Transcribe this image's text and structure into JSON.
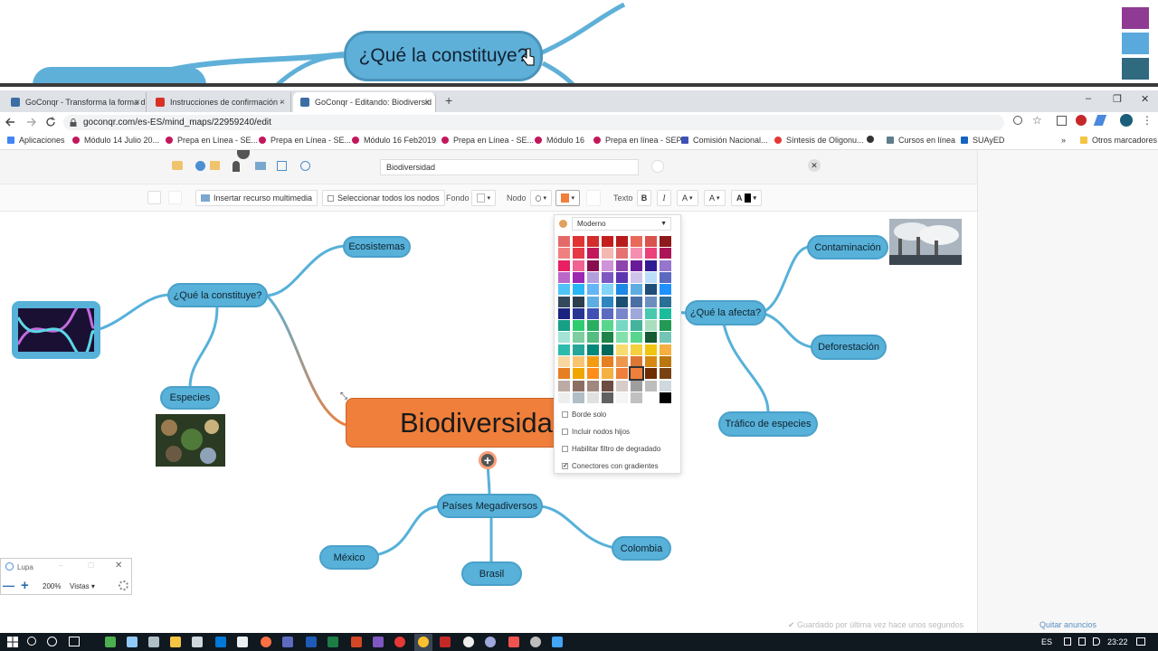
{
  "magnifier": {
    "node_text": "¿Qué la constituye?"
  },
  "tabs": [
    {
      "label": "GoConqr - Transforma la forma d",
      "close": "×"
    },
    {
      "label": "Instrucciones de confirmación - ",
      "close": "×"
    },
    {
      "label": "GoConqr - Editando: Biodiversid",
      "close": "×"
    }
  ],
  "new_tab": "+",
  "window": {
    "minimize": "–",
    "maximize": "❐",
    "close": "✕"
  },
  "address": {
    "url": "goconqr.com/es-ES/mind_maps/22959240/edit"
  },
  "bookmarks": [
    "Aplicaciones",
    "Módulo 14 Julio 20...",
    "Prepa en Línea - SE...",
    "Prepa en Línea - SE...",
    "Módulo 16 Feb2019",
    "Prepa en Línea - SE...",
    "Módulo 16",
    "Prepa en línea - SEP",
    "Comisión Nacional...",
    "Síntesis de Oligonu...",
    "",
    "Cursos en línea",
    "SUAyED"
  ],
  "bookmarks_more": "»",
  "bookmarks_other": "Otros marcadores",
  "editor": {
    "title_value": "Biodiversidad",
    "insert_media": "Insertar recurso multimedia",
    "select_all": "Seleccionar todos los nodos",
    "fondo_label": "Fondo",
    "nodo_label": "Nodo",
    "texto_label": "Texto",
    "bold": "B",
    "italic": "I",
    "font_size": "A",
    "text_case": "A",
    "text_color": "A",
    "close": "✕"
  },
  "palette": {
    "style": "Moderno",
    "options": [
      {
        "label": "Borde solo",
        "checked": false
      },
      {
        "label": "Incluir nodos hijos",
        "checked": false
      },
      {
        "label": "Habilitar filtro de degradado",
        "checked": false
      },
      {
        "label": "Conectores con gradientes",
        "checked": true
      }
    ]
  },
  "mindmap": {
    "central": "Biodiversida",
    "nodes": {
      "constituye": "¿Qué la constituye?",
      "ecosistemas": "Ecosistemas",
      "especies": "Especies",
      "afecta": "¿Qué la afecta?",
      "contaminacion": "Contaminación",
      "deforestacion": "Deforestación",
      "trafico": "Tráfico de especies",
      "megadiversos": "Países Megadiversos",
      "mexico": "México",
      "brasil": "Brasil",
      "colombia": "Colombia"
    },
    "add_button": "+"
  },
  "footer": {
    "saved": "Guardado por última vez hace unos segundos",
    "remove_ads": "Quitar anuncios"
  },
  "lupa": {
    "title": "Lupa",
    "minus": "—",
    "plus": "+",
    "zoom": "200%",
    "views": "Vistas ▾"
  },
  "taskbar": {
    "lang": "ES",
    "time": "23:22"
  },
  "colors": {
    "node": "#57b1d9",
    "central": "#ef7f3b",
    "selected_swatch": "#ef7f3b"
  }
}
